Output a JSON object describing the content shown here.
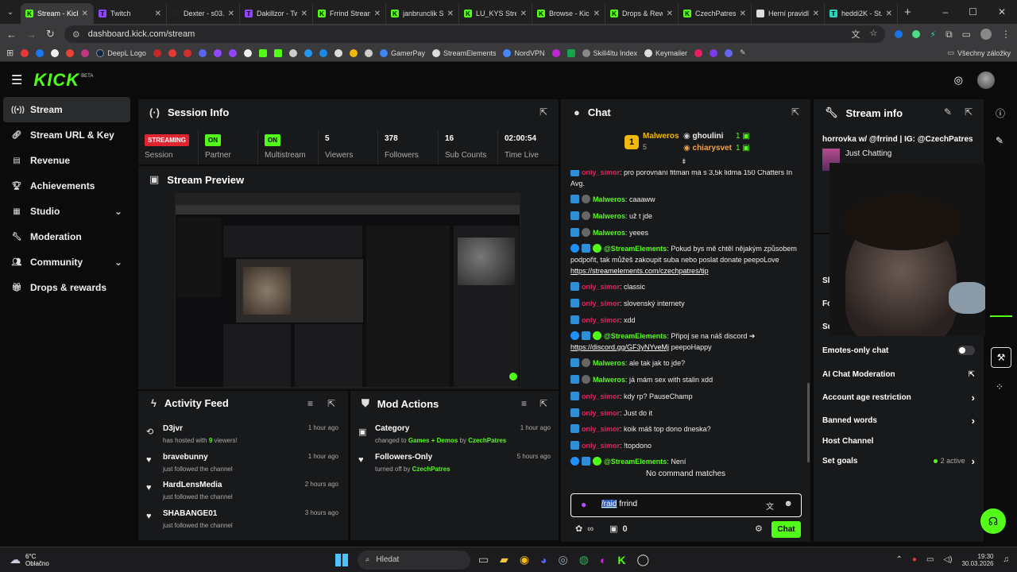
{
  "tabs": [
    {
      "title": "Stream - Kick",
      "color": "#53fc18",
      "glyph": "K",
      "active": true
    },
    {
      "title": "Twitch",
      "color": "#9146ff",
      "glyph": "T"
    },
    {
      "title": "Dexter - s03...",
      "color": "#222",
      "glyph": ""
    },
    {
      "title": "Dakillzor - Tw...",
      "color": "#9146ff",
      "glyph": "T"
    },
    {
      "title": "Frrind Stream...",
      "color": "#53fc18",
      "glyph": "K"
    },
    {
      "title": "janbrunclik S...",
      "color": "#53fc18",
      "glyph": "K"
    },
    {
      "title": "LU_KYS Strea...",
      "color": "#53fc18",
      "glyph": "K"
    },
    {
      "title": "Browse - Kick",
      "color": "#53fc18",
      "glyph": "K"
    },
    {
      "title": "Drops & Rew...",
      "color": "#53fc18",
      "glyph": "K"
    },
    {
      "title": "CzechPatres...",
      "color": "#53fc18",
      "glyph": "K"
    },
    {
      "title": "Herní pravidl...",
      "color": "#ddd",
      "glyph": ""
    },
    {
      "title": "heddi2K - St...",
      "color": "#2dd4bf",
      "glyph": "T"
    }
  ],
  "url": "dashboard.kick.com/stream",
  "bookmarks": [
    "DeepL Logo",
    "GamerPay",
    "StreamElements",
    "NordVPN",
    "Skill4ltu Index",
    "Keymailer"
  ],
  "bookmarks_folder": "Všechny záložky",
  "brand": {
    "logo": "KICK",
    "beta": "BETA",
    "accent": "#53fc18"
  },
  "sidebar": [
    {
      "label": "Stream",
      "icon": "broadcast-icon",
      "active": true
    },
    {
      "label": "Stream URL & Key",
      "icon": "link-icon"
    },
    {
      "label": "Revenue",
      "icon": "chart-icon"
    },
    {
      "label": "Achievements",
      "icon": "trophy-icon"
    },
    {
      "label": "Studio",
      "icon": "layout-icon",
      "chevron": true
    },
    {
      "label": "Moderation",
      "icon": "wrench-icon"
    },
    {
      "label": "Community",
      "icon": "people-icon",
      "chevron": true
    },
    {
      "label": "Drops & rewards",
      "icon": "gift-icon"
    }
  ],
  "session": {
    "title": "Session Info",
    "cells": [
      {
        "value": "STREAMING",
        "label": "Session",
        "badge": "red"
      },
      {
        "value": "ON",
        "label": "Partner",
        "badge": "green"
      },
      {
        "value": "ON",
        "label": "Multistream",
        "badge": "green"
      },
      {
        "value": "5",
        "label": "Viewers"
      },
      {
        "value": "378",
        "label": "Followers"
      },
      {
        "value": "16",
        "label": "Sub Counts"
      },
      {
        "value": "02:00:54",
        "label": "Time Live"
      }
    ]
  },
  "preview": {
    "title": "Stream Preview"
  },
  "activity": {
    "title": "Activity Feed",
    "items": [
      {
        "name": "D3jvr",
        "desc_pre": "has hosted with ",
        "desc_num": "9",
        "desc_post": " viewers!",
        "time": "1 hour ago",
        "icon": "host-icon"
      },
      {
        "name": "bravebunny",
        "desc": "just followed the channel",
        "time": "1 hour ago",
        "icon": "heart-icon"
      },
      {
        "name": "HardLensMedia",
        "desc": "just followed the channel",
        "time": "2 hours ago",
        "icon": "heart-icon"
      },
      {
        "name": "SHABANGE01",
        "desc": "just followed the channel",
        "time": "3 hours ago",
        "icon": "heart-icon"
      }
    ]
  },
  "mod_actions": {
    "title": "Mod Actions",
    "items": [
      {
        "name": "Category",
        "desc_pre": "changed to ",
        "highlight": "Games + Demos",
        "desc_mid": " by ",
        "by": "CzechPatres",
        "time": "1 hour ago",
        "icon": "category-icon"
      },
      {
        "name": "Followers-Only",
        "desc_pre": "turned off by ",
        "highlight": "",
        "desc_mid": "",
        "by": "CzechPatres",
        "time": "5 hours ago",
        "icon": "heart-icon"
      }
    ]
  },
  "chat": {
    "title": "Chat",
    "top_gifters": [
      {
        "name": "Malweros",
        "count": "5"
      },
      {
        "name": "ghoulini",
        "count": "1"
      },
      {
        "name": "chiarysvet",
        "count": "1"
      }
    ],
    "messages": [
      {
        "user": "only_simor",
        "color": "#e0245e",
        "text": "pro porovnání fitman má s 3,5k lidma 150 Chatters In Avg."
      },
      {
        "user": "Malweros",
        "color": "#53fc18",
        "text": "caaaww"
      },
      {
        "user": "Malweros",
        "color": "#53fc18",
        "text": "už t jde"
      },
      {
        "user": "Malweros",
        "color": "#53fc18",
        "text": "yeees"
      },
      {
        "user": "@StreamElements",
        "color": "#53fc18",
        "text": "Pokud bys mě chtěl nějakým způsobem podpořit, tak můžeš zakoupit suba nebo poslat donate peepoLove ",
        "link": "https://streamelements.com/czechpatres/tip"
      },
      {
        "user": "only_simor",
        "color": "#e0245e",
        "text": "classic"
      },
      {
        "user": "only_simor",
        "color": "#e0245e",
        "text": "slovenský internety"
      },
      {
        "user": "only_simor",
        "color": "#e0245e",
        "text": "xdd"
      },
      {
        "user": "@StreamElements",
        "color": "#53fc18",
        "text": "Připoj se na náš discord ➔ ",
        "link": "https://discord.gg/GF3yNYveMj",
        "text2": " peepoHappy"
      },
      {
        "user": "Malweros",
        "color": "#53fc18",
        "text": "ale tak jak to jde?"
      },
      {
        "user": "Malweros",
        "color": "#53fc18",
        "text": "já mám sex with stalin xdd"
      },
      {
        "user": "only_simor",
        "color": "#e0245e",
        "text": "kdy rp? PauseChamp"
      },
      {
        "user": "only_simor",
        "color": "#e0245e",
        "text": "Just do it"
      },
      {
        "user": "only_simor",
        "color": "#e0245e",
        "text": "koik máš top dono dneska?"
      },
      {
        "user": "only_simor",
        "color": "#e0245e",
        "text": "!topdono"
      },
      {
        "user": "@StreamElements",
        "color": "#53fc18",
        "text": "Není"
      }
    ],
    "no_match": "No command matches",
    "input_cmd": "/raid",
    "input_rest": " frrind",
    "count": "0",
    "send": "Chat"
  },
  "stream_info": {
    "title": "Stream info",
    "stream_title": "horrovka w/ @frrind | IG: @CzechPatres",
    "category": "Just Chatting",
    "partial_labels": [
      "Sl",
      "Fo",
      "Su"
    ],
    "rows": [
      {
        "label": "Emotes-only chat",
        "type": "toggle"
      },
      {
        "label": "AI Chat Moderation",
        "type": "external"
      },
      {
        "label": "Account age restriction",
        "type": "chevron"
      },
      {
        "label": "Banned words",
        "type": "chevron"
      },
      {
        "label": "Host Channel",
        "type": "none"
      },
      {
        "label": "Set goals",
        "type": "chevron",
        "status": "2 active"
      }
    ]
  },
  "taskbar": {
    "weather_temp": "6°C",
    "weather_desc": "Oblačno",
    "search": "Hledat",
    "time": "19:30",
    "date": "30.03.2026"
  }
}
